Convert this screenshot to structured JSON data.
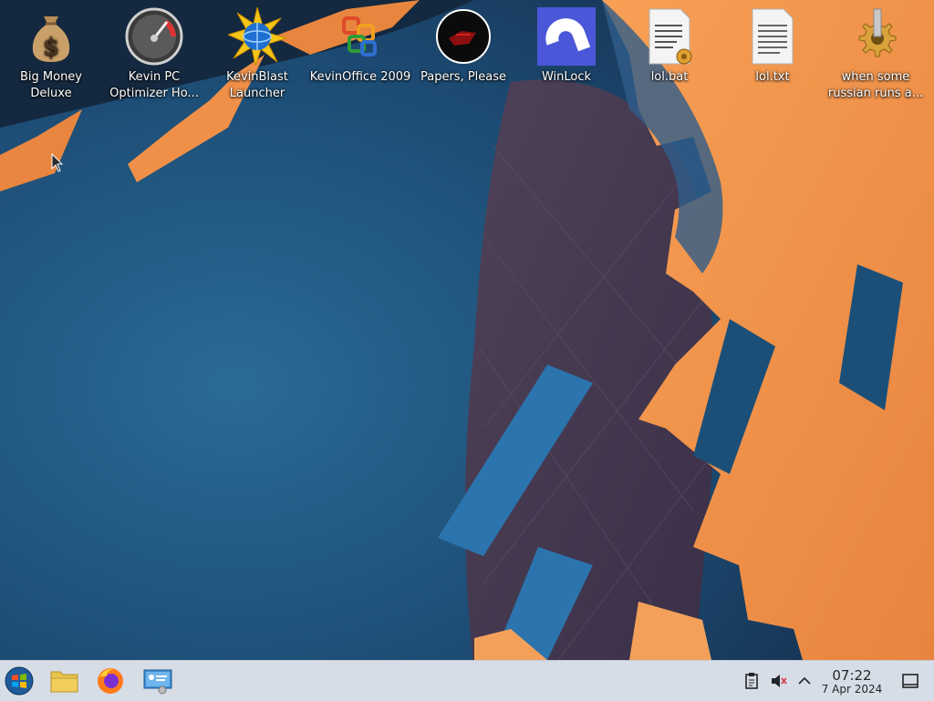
{
  "desktop": {
    "icons": [
      {
        "label": "Big Money Deluxe",
        "icon": "money-bag-icon"
      },
      {
        "label": "Kevin PC Optimizer Ho...",
        "icon": "speedometer-icon"
      },
      {
        "label": "KevinBlast Launcher",
        "icon": "starburst-globe-icon"
      },
      {
        "label": "KevinOffice 2009",
        "icon": "office-logo-icon"
      },
      {
        "label": "Papers, Please",
        "icon": "papers-please-icon"
      },
      {
        "label": "WinLock",
        "icon": "winlock-icon"
      },
      {
        "label": "lol.bat",
        "icon": "batch-file-icon"
      },
      {
        "label": "lol.txt",
        "icon": "text-file-icon"
      },
      {
        "label": "when some russian runs a...",
        "icon": "gear-icon"
      }
    ]
  },
  "taskbar": {
    "start": "start-orb-icon",
    "pinned": [
      "file-manager-icon",
      "firefox-icon",
      "system-settings-icon"
    ],
    "tray": [
      "clipboard-icon",
      "volume-muted-icon",
      "tray-expand-icon",
      "show-desktop-icon"
    ],
    "clock": {
      "time": "07:22",
      "date": "7 Apr 2024"
    }
  },
  "colors": {
    "wallpaper_blue": "#1c4f78",
    "wallpaper_orange": "#f08a42",
    "wallpaper_purple": "#4a3a55",
    "taskbar_bg": "#d7dde6"
  }
}
